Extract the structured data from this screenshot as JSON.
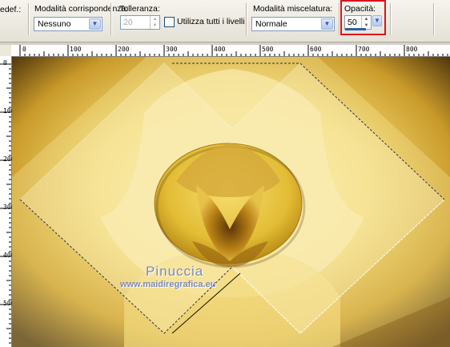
{
  "toolbar": {
    "cut_label": "edef.:",
    "match_mode": {
      "label": "Modalità corrispondenza:",
      "value": "Nessuno"
    },
    "tolerance": {
      "label": "Tolleranza:",
      "value": "20"
    },
    "use_all_layers": {
      "label": "Utilizza tutti i livelli",
      "checked": false
    },
    "blend_mode": {
      "label": "Modalità miscelatura:",
      "value": "Normale"
    },
    "opacity": {
      "label": "Opacità:",
      "value": "50",
      "highlight_color": "#e1101a"
    }
  },
  "ruler": {
    "horizontal": [
      "0",
      "100",
      "200",
      "300",
      "400",
      "500",
      "600",
      "700",
      "800"
    ],
    "vertical": [
      "0",
      "100",
      "200",
      "300",
      "400",
      "500"
    ]
  },
  "watermark": {
    "name": "Pinuccia",
    "url": "www.maidiregrafica.eu"
  }
}
